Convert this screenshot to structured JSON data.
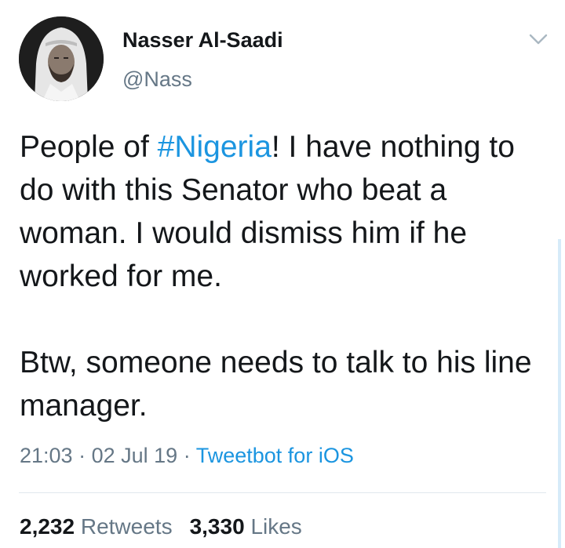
{
  "user": {
    "name": "Nasser Al-Saadi",
    "handle": "@Nass"
  },
  "tweet": {
    "line1_before": "People of ",
    "hashtag": "#Nigeria",
    "line1_after": "! I have nothing to do with this Senator who beat a woman. I would dismiss him if he worked for me.",
    "paragraph2": "Btw, someone needs to talk to his line manager."
  },
  "meta": {
    "time": "21:03",
    "date": "02 Jul 19",
    "separator": "·",
    "source": "Tweetbot for iOS"
  },
  "stats": {
    "retweets_count": "2,232",
    "retweets_label": "Retweets",
    "likes_count": "3,330",
    "likes_label": "Likes"
  },
  "icons": {
    "menu": "chevron-down-icon",
    "avatar": "profile-photo"
  },
  "colors": {
    "link": "#1b95e0",
    "secondary_text": "#657786",
    "primary_text": "#14171a",
    "divider": "#e1e8ed"
  }
}
